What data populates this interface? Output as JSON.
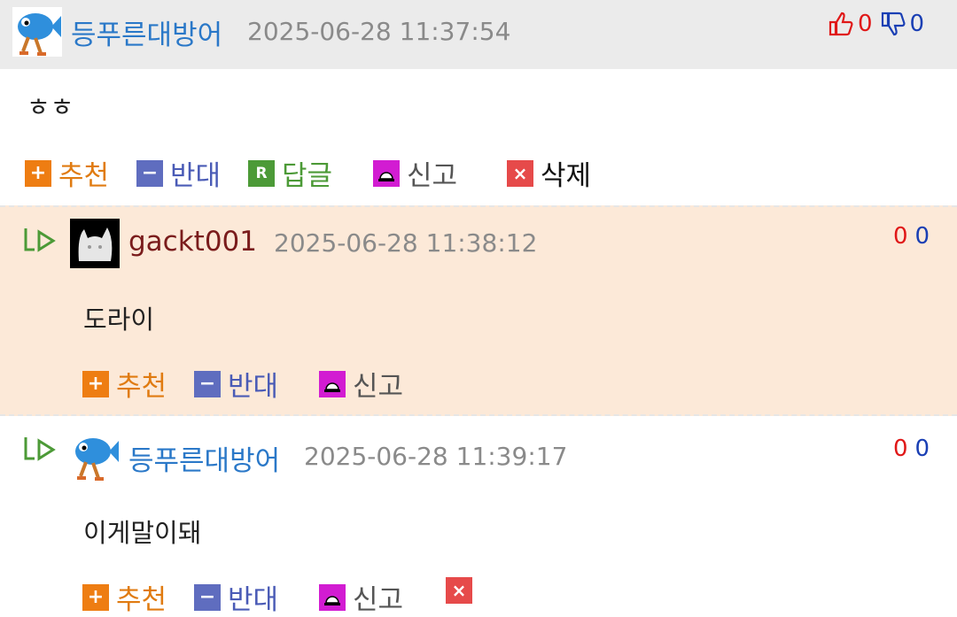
{
  "comments": [
    {
      "nickname": "등푸른대방어",
      "datetime": "2025-06-28 11:37:54",
      "body": "ㅎㅎ",
      "up": "0",
      "down": "0",
      "actions": {
        "recommend": "추천",
        "oppose": "반대",
        "reply": "답글",
        "report": "신고",
        "delete": "삭제"
      },
      "icons": {
        "reply_square": "R",
        "delete_square": "×"
      }
    },
    {
      "nickname": "gackt001",
      "datetime": "2025-06-28 11:38:12",
      "body": "도라이",
      "up": "0",
      "down": "0",
      "actions": {
        "recommend": "추천",
        "oppose": "반대",
        "report": "신고"
      }
    },
    {
      "nickname": "등푸른대방어",
      "datetime": "2025-06-28 11:39:17",
      "body": "이게말이돼",
      "up": "0",
      "down": "0",
      "actions": {
        "recommend": "추천",
        "oppose": "반대",
        "report": "신고"
      },
      "icons": {
        "delete_square": "×"
      }
    }
  ],
  "glyphs": {
    "plus": "+",
    "minus": "−"
  },
  "colors": {
    "nickname": "#2a78c8",
    "nickname_alt": "#7a1c1c",
    "recommend": "#ee7d12",
    "oppose": "#5f6dbf",
    "reply": "#4c9a37",
    "report": "#d21cd2",
    "delete": "#e64a4a",
    "vote_up": "#e01818",
    "vote_down": "#1a3fb4",
    "reply_highlight": "#fce9d8"
  }
}
